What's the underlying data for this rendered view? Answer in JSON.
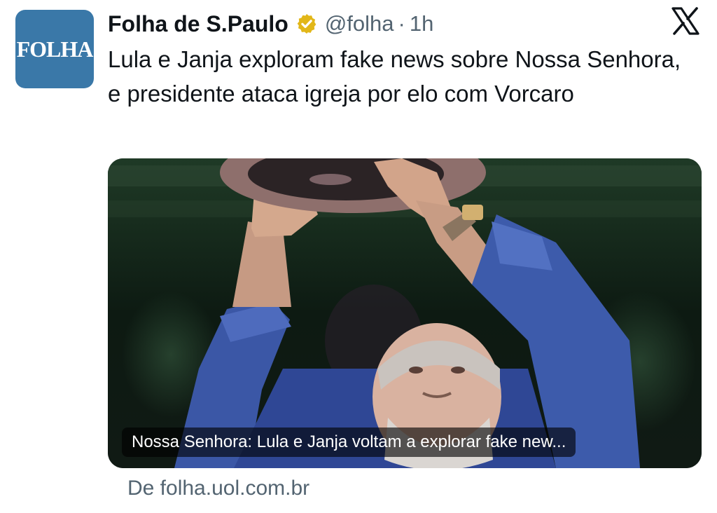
{
  "tweet": {
    "avatar_text": "FOLHA",
    "display_name": "Folha de S.Paulo",
    "verified_badge_icon": "verified-gold-badge-icon",
    "handle": "@folha",
    "separator": "·",
    "timestamp": "1h",
    "platform_icon": "x-logo-icon",
    "text": "Lula e Janja exploram fake news sobre Nossa Senhora, e presidente ataca igreja por elo com Vorcaro"
  },
  "link_card": {
    "caption": "Nossa Senhora: Lula e Janja voltam a explorar fake new...",
    "source": "De folha.uol.com.br"
  },
  "colors": {
    "avatar_bg": "#3a78a8",
    "verified_gold": "#e2b719",
    "secondary_text": "#536471",
    "primary_text": "#0f1419"
  }
}
